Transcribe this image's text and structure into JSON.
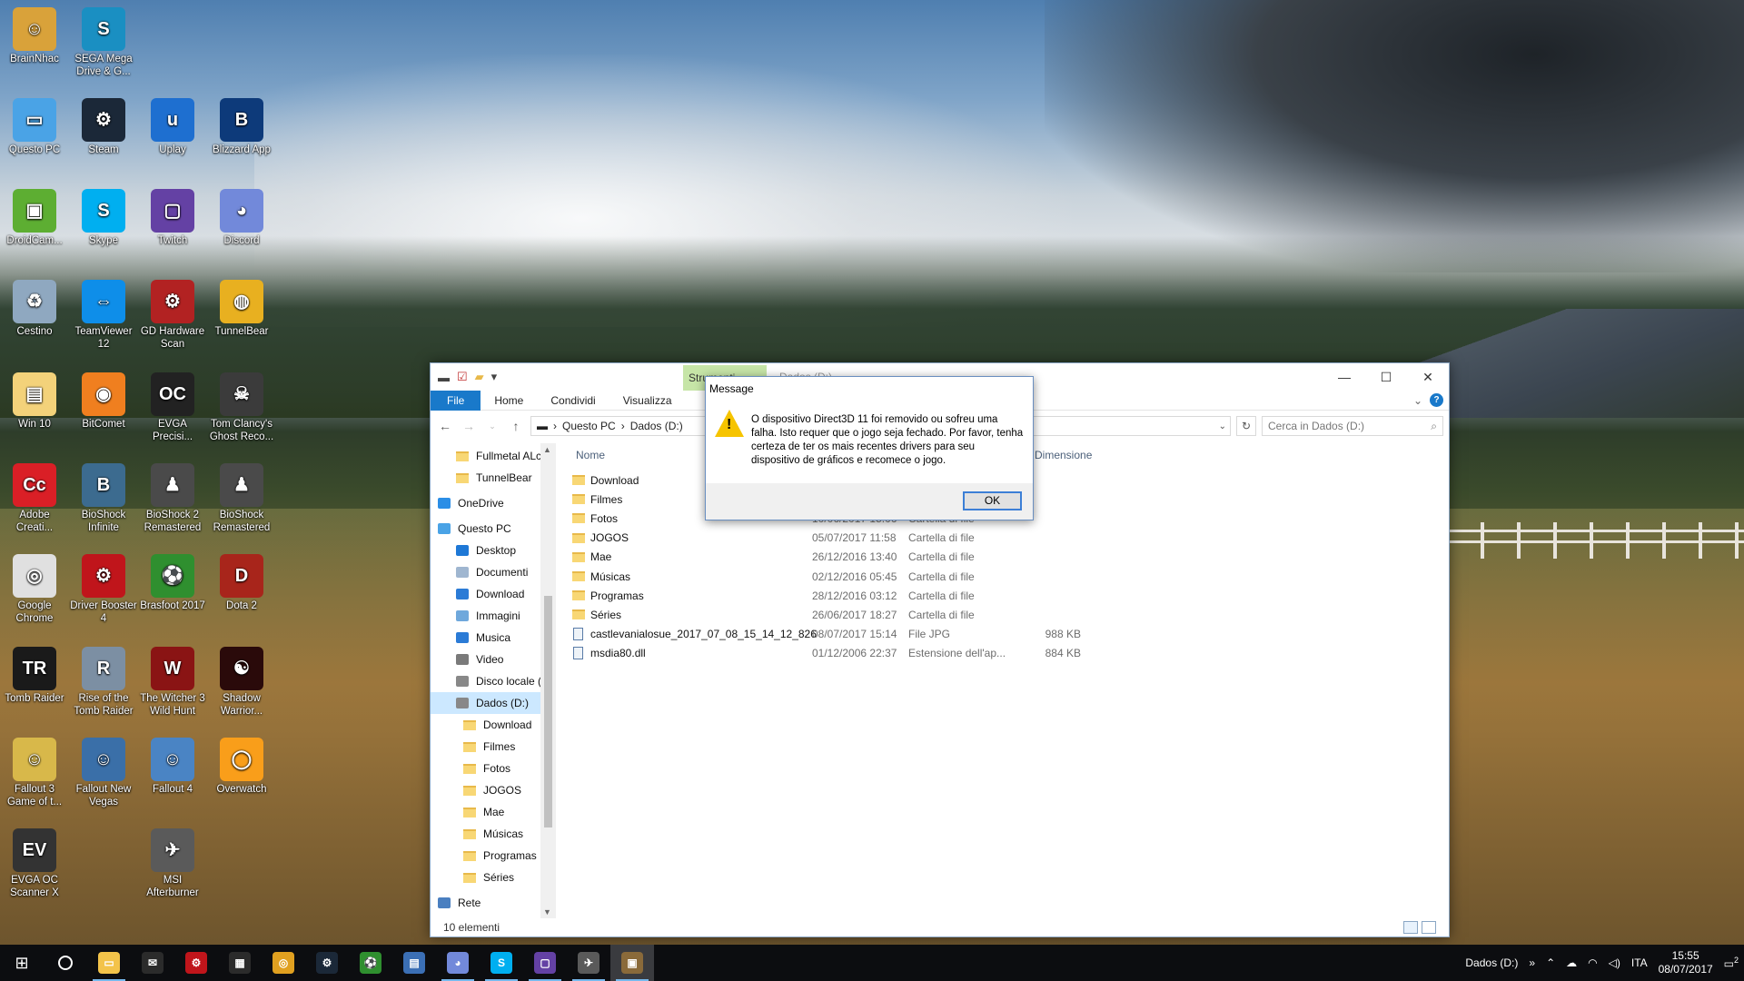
{
  "desktop": {
    "icons": [
      {
        "label": "BrainNhac",
        "color": "#d9a23a",
        "glyph": "☺"
      },
      {
        "label": "SEGA Mega Drive & G...",
        "color": "#1a8fc2",
        "glyph": "S"
      },
      {
        "label": "Questo PC",
        "color": "#4aa3e6",
        "glyph": "▭"
      },
      {
        "label": "Steam",
        "color": "#1b2838",
        "glyph": "⚙"
      },
      {
        "label": "Uplay",
        "color": "#1e6fd0",
        "glyph": "u"
      },
      {
        "label": "Blizzard App",
        "color": "#0d3a7a",
        "glyph": "B"
      },
      {
        "label": "DroidCam...",
        "color": "#5dae32",
        "glyph": "▣"
      },
      {
        "label": "Skype",
        "color": "#00aff0",
        "glyph": "S"
      },
      {
        "label": "Twitch",
        "color": "#6441a4",
        "glyph": "▢"
      },
      {
        "label": "Discord",
        "color": "#7289da",
        "glyph": "◕"
      },
      {
        "label": "Cestino",
        "color": "#8fa8c0",
        "glyph": "♻"
      },
      {
        "label": "TeamViewer 12",
        "color": "#0e8ee9",
        "glyph": "⇔"
      },
      {
        "label": "GD Hardware Scan",
        "color": "#b22222",
        "glyph": "⚙"
      },
      {
        "label": "TunnelBear",
        "color": "#e8b020",
        "glyph": "◍"
      },
      {
        "label": "Win 10",
        "color": "#f3d27a",
        "glyph": "▤"
      },
      {
        "label": "BitComet",
        "color": "#f07f1f",
        "glyph": "◉"
      },
      {
        "label": "EVGA Precisi...",
        "color": "#222222",
        "glyph": "OC"
      },
      {
        "label": "Tom Clancy's Ghost Reco...",
        "color": "#3b3b3b",
        "glyph": "☠"
      },
      {
        "label": "Adobe Creati...",
        "color": "#da1f26",
        "glyph": "Cc"
      },
      {
        "label": "BioShock Infinite",
        "color": "#3c6b8f",
        "glyph": "B"
      },
      {
        "label": "BioShock 2 Remastered",
        "color": "#4a4a4a",
        "glyph": "♟"
      },
      {
        "label": "BioShock Remastered",
        "color": "#4a4a4a",
        "glyph": "♟"
      },
      {
        "label": "Google Chrome",
        "color": "#e0e0e0",
        "glyph": "◎"
      },
      {
        "label": "Driver Booster 4",
        "color": "#c0151b",
        "glyph": "⚙"
      },
      {
        "label": "Brasfoot 2017",
        "color": "#2f8f2f",
        "glyph": "⚽"
      },
      {
        "label": "Dota 2",
        "color": "#a8251b",
        "glyph": "D"
      },
      {
        "label": "Tomb Raider",
        "color": "#1a1a1a",
        "glyph": "TR"
      },
      {
        "label": "Rise of the Tomb Raider",
        "color": "#7c8fa3",
        "glyph": "R"
      },
      {
        "label": "The Witcher 3 Wild Hunt",
        "color": "#8a1414",
        "glyph": "W"
      },
      {
        "label": "Shadow Warrior...",
        "color": "#2a0a0a",
        "glyph": "☯"
      },
      {
        "label": "Fallout 3 Game of t...",
        "color": "#d8b84a",
        "glyph": "☺"
      },
      {
        "label": "Fallout New Vegas",
        "color": "#3a6fa8",
        "glyph": "☺"
      },
      {
        "label": "Fallout 4",
        "color": "#4a84c4",
        "glyph": "☺"
      },
      {
        "label": "Overwatch",
        "color": "#f99e1a",
        "glyph": "◯"
      },
      {
        "label": "EVGA OC Scanner X",
        "color": "#333333",
        "glyph": "EV"
      },
      {
        "label": "MSI Afterburner",
        "color": "#5a5a5a",
        "glyph": "✈"
      }
    ]
  },
  "explorer": {
    "tools_tab": "Strumenti...",
    "title": "Dados (D:)",
    "ribbon_tabs": [
      "File",
      "Home",
      "Condividi",
      "Visualizza"
    ],
    "breadcrumb": [
      "Questo PC",
      "Dados (D:)"
    ],
    "search_placeholder": "Cerca in Dados (D:)",
    "columns": {
      "name": "Nome",
      "size": "Dimensione"
    },
    "nav_items": [
      {
        "label": "Fullmetal ALche",
        "type": "folder",
        "indent": 1
      },
      {
        "label": "TunnelBear",
        "type": "folder",
        "indent": 1
      },
      {
        "label": "OneDrive",
        "type": "onedrive",
        "indent": 0
      },
      {
        "label": "Questo PC",
        "type": "pc",
        "indent": 0
      },
      {
        "label": "Desktop",
        "type": "desktop",
        "indent": 1
      },
      {
        "label": "Documenti",
        "type": "docs",
        "indent": 1
      },
      {
        "label": "Download",
        "type": "download",
        "indent": 1
      },
      {
        "label": "Immagini",
        "type": "images",
        "indent": 1
      },
      {
        "label": "Musica",
        "type": "music",
        "indent": 1
      },
      {
        "label": "Video",
        "type": "video",
        "indent": 1
      },
      {
        "label": "Disco locale (C:)",
        "type": "drive",
        "indent": 1
      },
      {
        "label": "Dados (D:)",
        "type": "drive",
        "indent": 1,
        "selected": true
      },
      {
        "label": "Download",
        "type": "folder",
        "indent": 2
      },
      {
        "label": "Filmes",
        "type": "folder",
        "indent": 2
      },
      {
        "label": "Fotos",
        "type": "folder",
        "indent": 2
      },
      {
        "label": "JOGOS",
        "type": "folder",
        "indent": 2
      },
      {
        "label": "Mae",
        "type": "folder",
        "indent": 2
      },
      {
        "label": "Músicas",
        "type": "folder",
        "indent": 2
      },
      {
        "label": "Programas",
        "type": "folder",
        "indent": 2
      },
      {
        "label": "Séries",
        "type": "folder",
        "indent": 2
      },
      {
        "label": "Rete",
        "type": "network",
        "indent": 0
      }
    ],
    "files": [
      {
        "name": "Download",
        "date": "",
        "type": "",
        "size": "",
        "kind": "folder"
      },
      {
        "name": "Filmes",
        "date": "",
        "type": "",
        "size": "",
        "kind": "folder"
      },
      {
        "name": "Fotos",
        "date": "10/06/2017 15:06",
        "type": "Cartella di file",
        "size": "",
        "kind": "folder"
      },
      {
        "name": "JOGOS",
        "date": "05/07/2017 11:58",
        "type": "Cartella di file",
        "size": "",
        "kind": "folder"
      },
      {
        "name": "Mae",
        "date": "26/12/2016 13:40",
        "type": "Cartella di file",
        "size": "",
        "kind": "folder"
      },
      {
        "name": "Músicas",
        "date": "02/12/2016 05:45",
        "type": "Cartella di file",
        "size": "",
        "kind": "folder"
      },
      {
        "name": "Programas",
        "date": "28/12/2016 03:12",
        "type": "Cartella di file",
        "size": "",
        "kind": "folder"
      },
      {
        "name": "Séries",
        "date": "26/06/2017 18:27",
        "type": "Cartella di file",
        "size": "",
        "kind": "folder"
      },
      {
        "name": "castlevanialosue_2017_07_08_15_14_12_826",
        "date": "08/07/2017 15:14",
        "type": "File JPG",
        "size": "988 KB",
        "kind": "file"
      },
      {
        "name": "msdia80.dll",
        "date": "01/12/2006 22:37",
        "type": "Estensione dell'ap...",
        "size": "884 KB",
        "kind": "file"
      }
    ],
    "status": "10 elementi"
  },
  "dialog": {
    "title": "Message",
    "message": "O dispositivo Direct3D 11 foi removido ou sofreu uma falha. Isto requer que o jogo seja fechado. Por favor, tenha certeza de ter os mais recentes drivers para seu dispositivo de gráficos e recomece o jogo.",
    "ok_label": "OK"
  },
  "taskbar": {
    "apps": [
      {
        "name": "file-explorer",
        "color": "#f3c34a",
        "glyph": "▭",
        "running": true
      },
      {
        "name": "mail",
        "color": "#2b2b2b",
        "glyph": "✉",
        "running": false
      },
      {
        "name": "driver-booster",
        "color": "#c0151b",
        "glyph": "⚙",
        "running": false
      },
      {
        "name": "calendar-app",
        "color": "#2b2b2b",
        "glyph": "▦",
        "running": false
      },
      {
        "name": "chrome",
        "color": "#e0a020",
        "glyph": "◎",
        "running": false
      },
      {
        "name": "steam",
        "color": "#1b2838",
        "glyph": "⚙",
        "running": false
      },
      {
        "name": "brasfoot",
        "color": "#2f8f2f",
        "glyph": "⚽",
        "running": false
      },
      {
        "name": "network-app",
        "color": "#3b6fb5",
        "glyph": "▤",
        "running": false
      },
      {
        "name": "discord",
        "color": "#7289da",
        "glyph": "◕",
        "running": true
      },
      {
        "name": "skype",
        "color": "#00aff0",
        "glyph": "S",
        "running": true
      },
      {
        "name": "twitch",
        "color": "#6441a4",
        "glyph": "▢",
        "running": true
      },
      {
        "name": "msi-afterburner",
        "color": "#5a5a5a",
        "glyph": "✈",
        "running": true
      },
      {
        "name": "game-window",
        "color": "#8a6a3a",
        "glyph": "▣",
        "running": true,
        "active": true
      }
    ],
    "tray": {
      "drive_label": "Dados (D:)",
      "language": "ITA",
      "time": "15:55",
      "date": "08/07/2017",
      "notifications": "2"
    }
  }
}
